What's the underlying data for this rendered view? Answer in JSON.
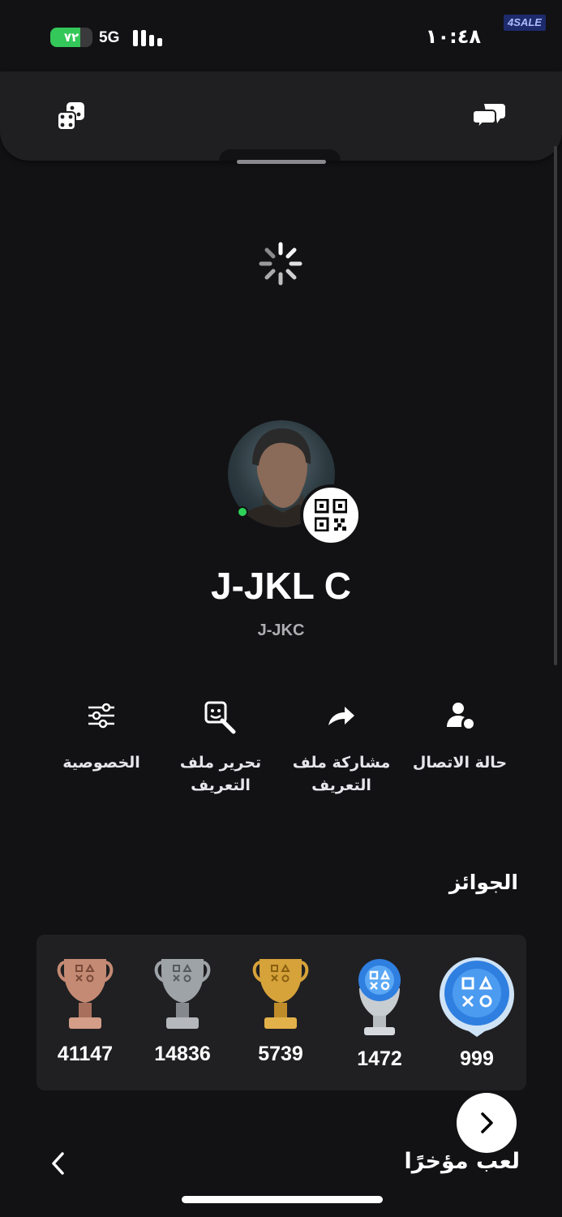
{
  "status_bar": {
    "battery_label": "٧٢",
    "battery_percent": 72,
    "network": "5G",
    "time": "١٠:٤٨",
    "badge": "4SALE"
  },
  "top_sheet": {
    "left_icon": "dice-icon",
    "right_icon": "chat-bubbles-icon"
  },
  "profile": {
    "name": "J-JKL C",
    "online_id": "J-JKC",
    "avatar_icon": "avatar-portrait",
    "online_status_color": "#2ed158"
  },
  "actions": [
    {
      "label": "حالة الاتصال",
      "icon": "person-status-icon"
    },
    {
      "label": "مشاركة ملف التعريف",
      "icon": "share-arrow-icon"
    },
    {
      "label": "تحرير ملف التعريف",
      "icon": "edit-profile-icon"
    },
    {
      "label": "الخصوصية",
      "icon": "sliders-icon"
    }
  ],
  "trophies": {
    "title": "الجوائز",
    "items": [
      {
        "type": "level",
        "count": "999",
        "icon": "trophy-level-icon"
      },
      {
        "type": "platinum",
        "count": "1472",
        "icon": "platinum-trophy-icon"
      },
      {
        "type": "gold",
        "count": "5739",
        "icon": "gold-trophy-icon"
      },
      {
        "type": "silver",
        "count": "14836",
        "icon": "silver-trophy-icon"
      },
      {
        "type": "bronze",
        "count": "41147",
        "icon": "bronze-trophy-icon"
      }
    ]
  },
  "recently_played": {
    "title": "لعب مؤخرًا"
  },
  "colors": {
    "background": "#121214",
    "card": "#202022",
    "gold": "#d6a23a",
    "silver": "#9ea3a8",
    "bronze": "#c48a74",
    "platinum_blue": "#2f7fe0"
  }
}
